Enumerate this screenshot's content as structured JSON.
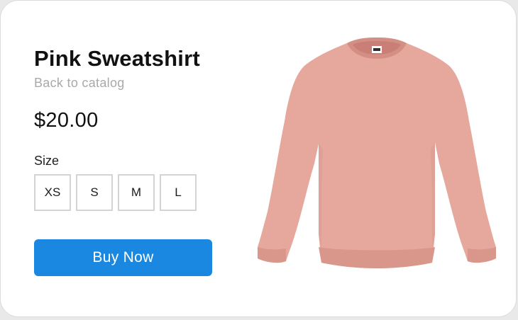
{
  "product": {
    "title": "Pink Sweatshirt",
    "back_link": "Back to catalog",
    "price": "$20.00",
    "image_icon": "pink-sweatshirt-image",
    "image_color": "#e6a79c"
  },
  "sizes": {
    "label": "Size",
    "options": [
      "XS",
      "S",
      "M",
      "L"
    ]
  },
  "actions": {
    "buy_label": "Buy Now",
    "buy_color": "#1a88e0"
  }
}
